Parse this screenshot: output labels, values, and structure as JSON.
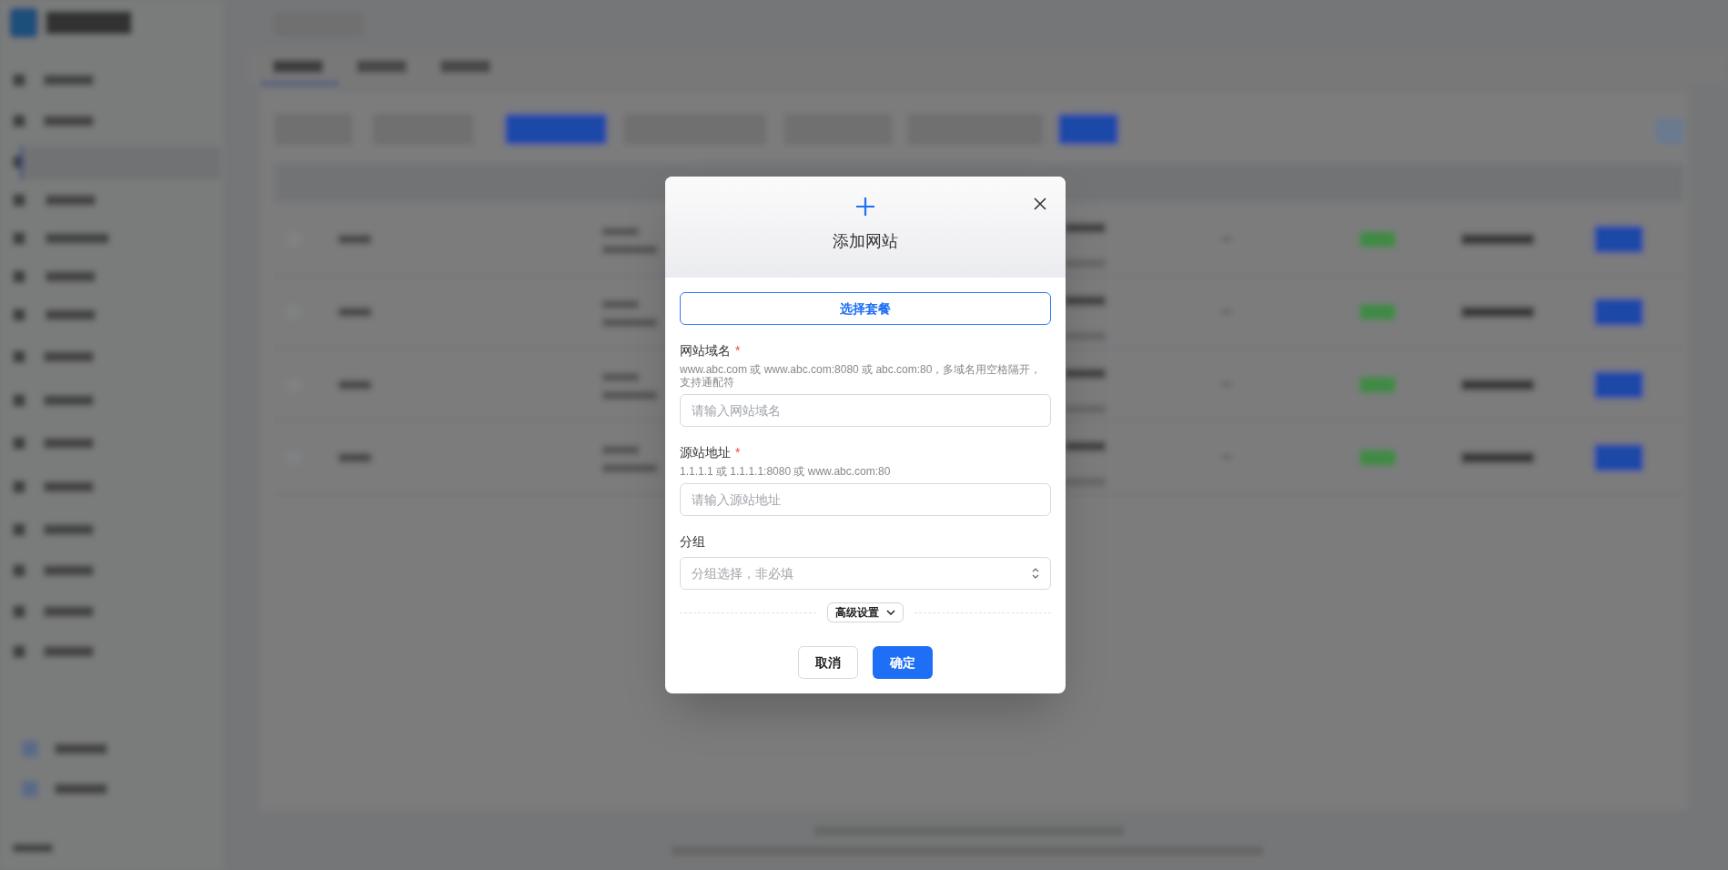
{
  "dialog": {
    "title": "添加网站",
    "package_button": "选择套餐",
    "fields": [
      {
        "kind": "text",
        "label": "网站域名",
        "required_mark": "*",
        "hint": "www.abc.com 或 www.abc.com:8080 或 abc.com:80，多域名用空格隔开，支持通配符",
        "placeholder": "请输入网站域名"
      },
      {
        "kind": "text",
        "label": "源站地址",
        "required_mark": "*",
        "hint": "1.1.1.1 或 1.1.1.1:8080 或 www.abc.com:80",
        "placeholder": "请输入源站地址"
      },
      {
        "kind": "select",
        "label": "分组",
        "placeholder": "分组选择，非必填"
      }
    ],
    "advanced_toggle": {
      "label": "高级设置",
      "expanded": false
    },
    "buttons": [
      {
        "label": "取消",
        "kind": "secondary"
      },
      {
        "label": "确定",
        "kind": "primary"
      }
    ]
  }
}
